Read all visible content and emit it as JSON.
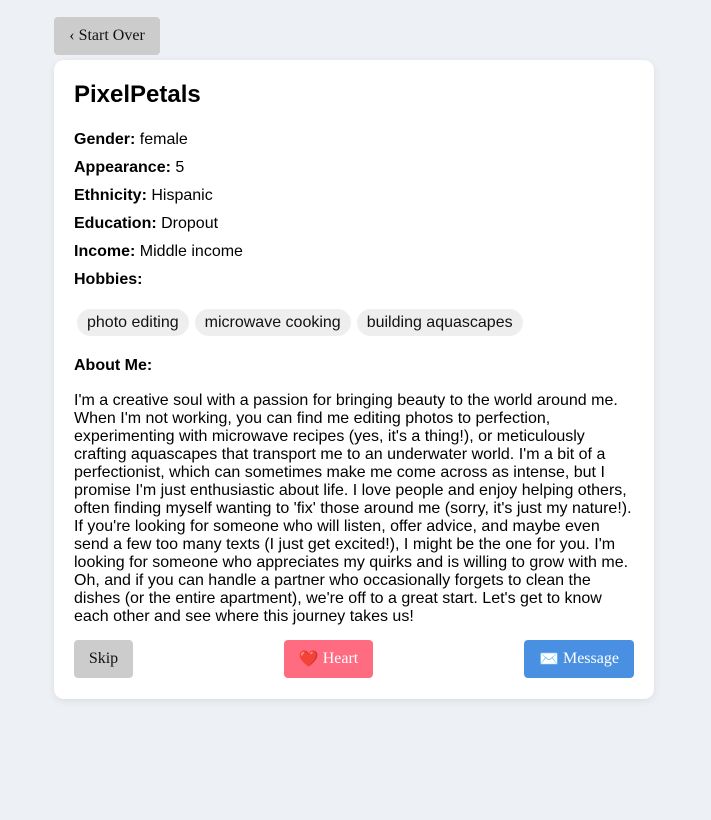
{
  "nav": {
    "start_over_label": "Start Over",
    "start_over_icon": "chevron-left-icon"
  },
  "profile": {
    "name": "PixelPetals",
    "fields": [
      {
        "label": "Gender:",
        "value": "female"
      },
      {
        "label": "Appearance:",
        "value": "5"
      },
      {
        "label": "Ethnicity:",
        "value": "Hispanic"
      },
      {
        "label": "Education:",
        "value": "Dropout"
      },
      {
        "label": "Income:",
        "value": "Middle income"
      },
      {
        "label": "Hobbies:",
        "value": ""
      }
    ],
    "hobbies": [
      "photo editing",
      "microwave cooking",
      "building aquascapes"
    ],
    "about_title": "About Me:",
    "about_text": "I'm a creative soul with a passion for bringing beauty to the world around me. When I'm not working, you can find me editing photos to perfection, experimenting with microwave recipes (yes, it's a thing!), or meticulously crafting aquascapes that transport me to an underwater world. I'm a bit of a perfectionist, which can sometimes make me come across as intense, but I promise I'm just enthusiastic about life. I love people and enjoy helping others, often finding myself wanting to 'fix' those around me (sorry, it's just my nature!). If you're looking for someone who will listen, offer advice, and maybe even send a few too many texts (I just get excited!), I might be the one for you. I'm looking for someone who appreciates my quirks and is willing to grow with me. Oh, and if you can handle a partner who occasionally forgets to clean the dishes (or the entire apartment), we're off to a great start. Let's get to know each other and see where this journey takes us!"
  },
  "actions": {
    "skip_label": "Skip",
    "heart_label": "Heart",
    "heart_icon": "heart-icon",
    "message_label": "Message",
    "message_icon": "envelope-icon"
  },
  "colors": {
    "background": "#edf0f4",
    "heart_button": "#ff6b81",
    "message_button": "#4a90e2",
    "neutral_button": "#cccccc",
    "tag_background": "#eeeeee"
  }
}
